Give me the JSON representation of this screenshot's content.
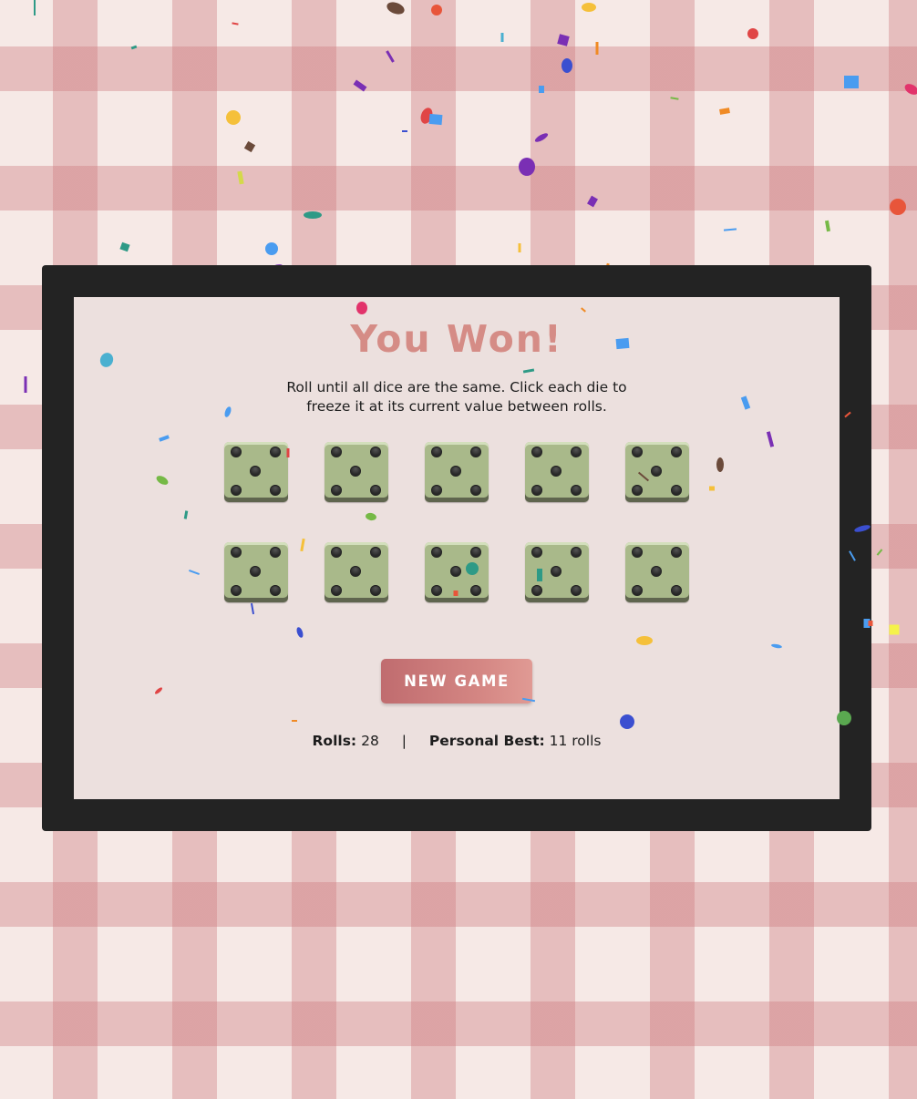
{
  "game": {
    "title": "You Won!",
    "instructions": "Roll until all dice are the same. Click each die to freeze it at its current value between rolls.",
    "new_game_label": "NEW GAME",
    "dice_values": [
      5,
      5,
      5,
      5,
      5,
      5,
      5,
      5,
      5,
      5
    ],
    "stats": {
      "rolls_label": "Rolls:",
      "rolls_value": "28",
      "separator": "|",
      "best_label": "Personal Best:",
      "best_value": "11 rolls"
    }
  },
  "colors": {
    "accent": "#d58c86",
    "button": "#c06c6f",
    "die_face": "#a9b98a",
    "board": "#ece0de",
    "frame": "#232323"
  }
}
